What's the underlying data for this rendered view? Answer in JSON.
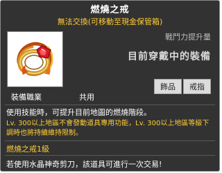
{
  "tooltip": {
    "title": "燃燒之戒",
    "subtitle": "無法交換(可移動至現金保管箱)",
    "power_label": "戰鬥力提升量",
    "equip_status": "目前穿戴中的裝備",
    "tags": [
      "飾品",
      "戒指"
    ],
    "job_label": "裝備職業",
    "job_value": "共用",
    "description": "使用技能時，可提升目前地圖的燃燒階段。",
    "note": "Lv. 300以上地區不會發動道具專用功能，Lv. 300以上地區等級下調時也將持續維持限制。",
    "level": "燃燒之戒1級",
    "footer": "若使用水晶神奇剪刀，該道具可進行一次交易!",
    "item_icon": "ring-icon",
    "colors": {
      "background": "#323232",
      "title": "#ffffff",
      "highlight": "#ffcc33",
      "tag_bg": "#dcdcdc"
    }
  }
}
